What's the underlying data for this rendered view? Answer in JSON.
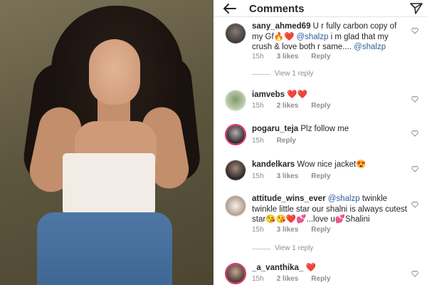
{
  "header": {
    "title": "Comments"
  },
  "comments": [
    {
      "username": "sany_ahmed69",
      "text_before": "U r fully carbon copy of my Gf🔥❤️ ",
      "mention1": "@shalzp",
      "text_mid": " i m glad that my crush & love both r same.... ",
      "mention2": "@shalzp",
      "time": "15h",
      "likes": "3 likes",
      "reply": "Reply",
      "view_replies": "View 1 reply"
    },
    {
      "username": "iamvebs",
      "text": "❤️❤️",
      "time": "15h",
      "likes": "2 likes",
      "reply": "Reply"
    },
    {
      "username": "pogaru_teja",
      "text": "Plz follow me",
      "time": "15h",
      "likes": "",
      "reply": "Reply"
    },
    {
      "username": "kandelkars",
      "text": "Wow nice jacket😍",
      "time": "15h",
      "likes": "3 likes",
      "reply": "Reply"
    },
    {
      "username": "attitude_wins_ever",
      "mention": "@shalzp",
      "text": " twinkle twinkle little star our shalni is always cutest star😘😘❤️💕...love u💕Shalini",
      "time": "15h",
      "likes": "3 likes",
      "reply": "Reply",
      "view_replies": "View 1 reply"
    },
    {
      "username": "_a_vanthika_",
      "text": "❤️",
      "time": "15h",
      "likes": "2 likes",
      "reply": "Reply"
    }
  ],
  "colors": {
    "mention": "#2f5d9a",
    "meta": "#8e8e8e",
    "story_ring": "#e1306c"
  },
  "icons": [
    "back-arrow-icon",
    "send-icon",
    "heart-icon"
  ]
}
